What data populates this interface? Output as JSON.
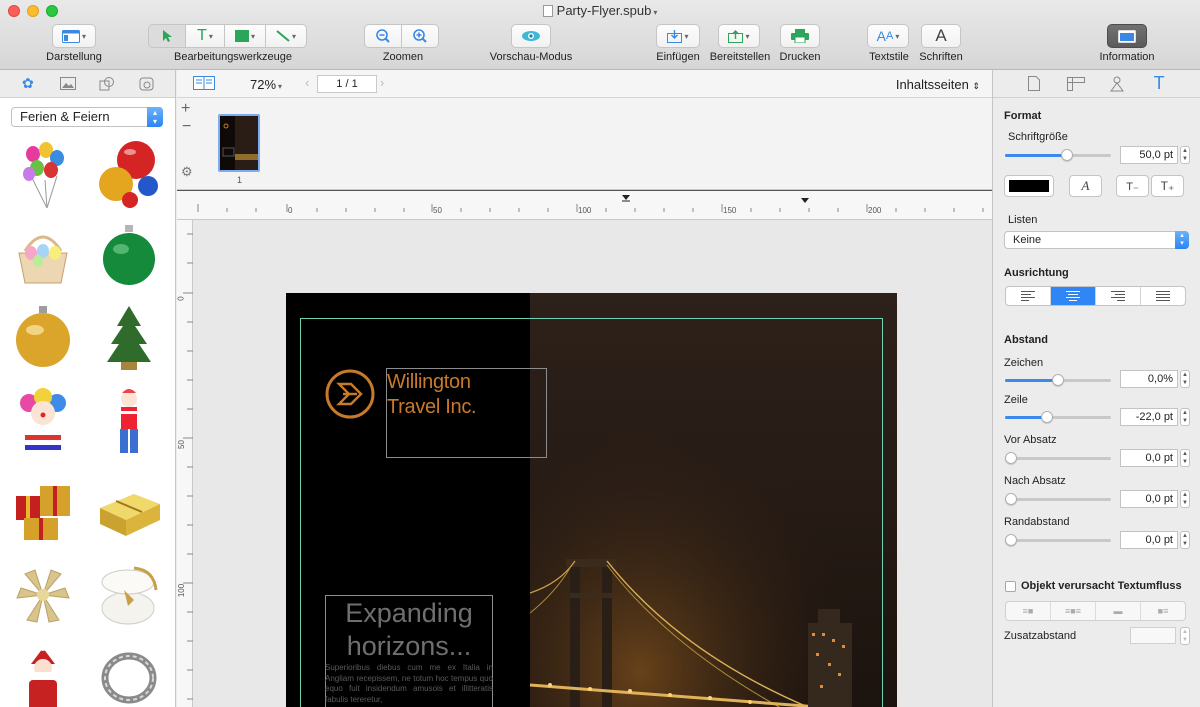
{
  "window": {
    "title": "Party-Flyer.spub"
  },
  "toolbar": {
    "darstellung": "Darstellung",
    "bearbeitungswerkzeuge": "Bearbeitungswerkzeuge",
    "zoomen": "Zoomen",
    "vorschau": "Vorschau-Modus",
    "einfuegen": "Einfügen",
    "bereitstellen": "Bereitstellen",
    "drucken": "Drucken",
    "textstile": "Textstile",
    "schriften": "Schriften",
    "information": "Information"
  },
  "library": {
    "category": "Ferien & Feiern",
    "clips": [
      "balloons",
      "christmas-balls",
      "easter-basket",
      "green-ornament",
      "gold-ornament",
      "christmas-tree",
      "clown",
      "clown-child",
      "red-gifts",
      "gold-gift",
      "gold-bow",
      "gift-box-open",
      "santa",
      "silver-ring"
    ]
  },
  "canvas": {
    "zoom": "72%",
    "page_indicator": "1 / 1",
    "section_select": "Inhaltsseiten",
    "thumbnail_number": "1",
    "ruler_h": [
      "0",
      "50",
      "100",
      "150",
      "200"
    ],
    "ruler_v": [
      "0",
      "50",
      "100"
    ]
  },
  "flyer": {
    "logo_line1": "Willington",
    "logo_line2": "Travel Inc.",
    "headline_line1": "Expanding",
    "headline_line2": "horizons...",
    "body": "Superioribus diebus cum me ex Italia in Angliam recepissem, ne totum hoc tempus quo equo fuit insidendum amusois et illitteratis fabulis tereretur,"
  },
  "inspector": {
    "format": "Format",
    "schriftgroesse": "Schriftgröße",
    "schriftgroesse_value": "50,0 pt",
    "listen": "Listen",
    "listen_value": "Keine",
    "ausrichtung": "Ausrichtung",
    "abstand": "Abstand",
    "zeichen": "Zeichen",
    "zeichen_value": "0,0%",
    "zeile": "Zeile",
    "zeile_value": "-22,0 pt",
    "vor_absatz": "Vor Absatz",
    "vor_absatz_value": "0,0 pt",
    "nach_absatz": "Nach Absatz",
    "nach_absatz_value": "0,0 pt",
    "randabstand": "Randabstand",
    "randabstand_value": "0,0 pt",
    "textumfluss": "Objekt verursacht Textumfluss",
    "zusatzabstand": "Zusatzabstand",
    "text_color": "#000000",
    "sliders": {
      "schriftgroesse": 0.6,
      "zeichen": 0.5,
      "zeile": 0.4,
      "vor_absatz": 0.0,
      "nach_absatz": 0.0,
      "randabstand": 0.0
    }
  },
  "colors": {
    "accent": "#2f86f4",
    "logo_orange": "#c87a2a",
    "guide": "#6fd2b5"
  }
}
